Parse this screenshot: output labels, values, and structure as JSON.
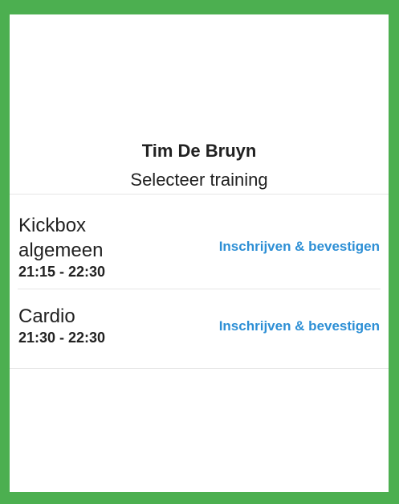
{
  "header": {
    "user_name": "Tim De Bruyn",
    "subtitle": "Selecteer training"
  },
  "trainings": [
    {
      "name": "Kickbox algemeen",
      "time": "21:15 - 22:30",
      "action_label": "Inschrijven & bevestigen"
    },
    {
      "name": "Cardio",
      "time": "21:30 - 22:30",
      "action_label": "Inschrijven & bevestigen"
    }
  ],
  "colors": {
    "frame_border": "#4caf50",
    "link": "#2d8fd5",
    "text": "#212121",
    "divider": "#e6e6e6"
  }
}
